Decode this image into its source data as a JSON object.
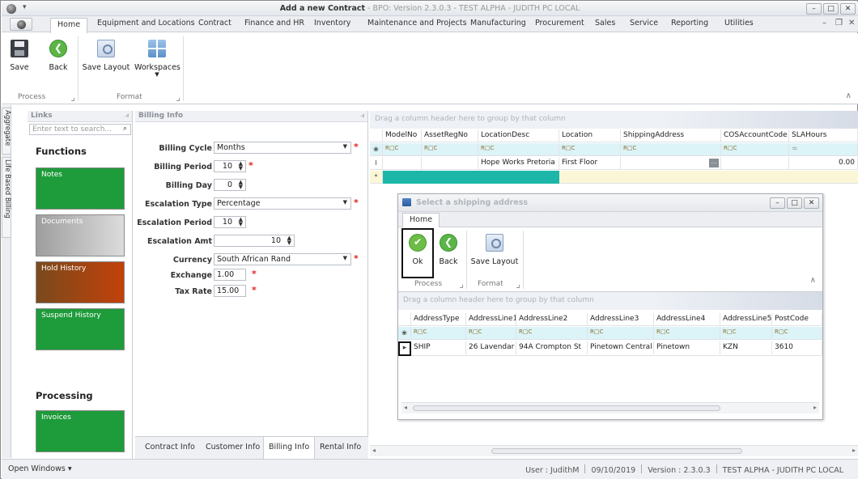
{
  "window": {
    "title_main": "Add a new Contract",
    "title_sub": " - BPO: Version 2.3.0.3 - TEST ALPHA - JUDITH PC LOCAL",
    "qat_glyph": "▾",
    "min": "–",
    "max": "□",
    "close": "✕"
  },
  "ribbon_tabs": [
    "Home",
    "Equipment and Locations",
    "Contract",
    "Finance and HR",
    "Inventory",
    "Maintenance and Projects",
    "Manufacturing",
    "Procurement",
    "Sales",
    "Service",
    "Reporting",
    "Utilities"
  ],
  "mdi_controls": {
    "min": "–",
    "restore": "❐",
    "close": "✕"
  },
  "ribbon": {
    "save": "Save",
    "back": "Back",
    "save_layout": "Save Layout",
    "workspaces": "Workspaces",
    "group_process": "Process",
    "group_format": "Format",
    "collapse": "∧"
  },
  "side_tabs": [
    "Aggregate",
    "Life Based Billing"
  ],
  "links": {
    "header": "Links",
    "pin": "⫣",
    "search_placeholder": "Enter text to search...",
    "search_icon": "⌕",
    "functions_title": "Functions",
    "tiles": [
      "Notes",
      "Documents",
      "Hold History",
      "Suspend History"
    ],
    "processing_title": "Processing",
    "processing_tiles": [
      "Invoices"
    ]
  },
  "billing": {
    "header": "Billing Info",
    "pin": "⫣",
    "fields": {
      "billing_cycle": {
        "label": "Billing Cycle",
        "value": "Months"
      },
      "billing_period": {
        "label": "Billing Period",
        "value": "10"
      },
      "billing_day": {
        "label": "Billing Day",
        "value": "0"
      },
      "escalation_type": {
        "label": "Escalation Type",
        "value": "Percentage"
      },
      "escalation_period": {
        "label": "Escalation Period",
        "value": "10"
      },
      "escalation_amt": {
        "label": "Escalation Amt",
        "value": "10"
      },
      "currency": {
        "label": "Currency",
        "value": "South African Rand"
      },
      "exchange": {
        "label": "Exchange",
        "value": "1.00"
      },
      "tax_rate": {
        "label": "Tax Rate",
        "value": "15.00"
      }
    },
    "required_mark": "*",
    "tabs": [
      "Contract Info",
      "Customer Info",
      "Billing Info",
      "Rental Info"
    ],
    "active_tab": "Billing Info"
  },
  "grid": {
    "group_hint": "Drag a column header here to group by that column",
    "columns": [
      "ModelNo",
      "AssetRegNo",
      "LocationDesc",
      "Location",
      "ShippingAddress",
      "COSAccountCode",
      "SLAHours"
    ],
    "filter_glyph": "R□C",
    "row": {
      "indicator": "I",
      "LocationDesc": "Hope Works Pretoria",
      "Location": "First Floor",
      "ShippingAddress_btn": "...",
      "SLAHours": "0.00"
    },
    "new_row_indicator": "*",
    "filter_indicator": "❀",
    "sla_filter": "="
  },
  "dialog": {
    "title": "Select a shipping address",
    "tab": "Home",
    "ok": "Ok",
    "back": "Back",
    "save_layout": "Save Layout",
    "group_process": "Process",
    "group_format": "Format",
    "collapse": "∧",
    "group_hint": "Drag a column header here to group by that column",
    "columns": [
      "AddressType",
      "AddressLine1",
      "AddressLine2",
      "AddressLine3",
      "AddressLine4",
      "AddressLine5",
      "PostCode"
    ],
    "row": {
      "AddressType": "SHIP",
      "AddressLine1": "26 Lavendar",
      "AddressLine2": "94A Crompton St",
      "AddressLine3": "Pinetown Central",
      "AddressLine4": "Pinetown",
      "AddressLine5": "KZN",
      "PostCode": "3610"
    },
    "row_indicator": "▸",
    "filter_indicator": "❀",
    "scroll_left": "◂",
    "scroll_right": "▸"
  },
  "status": {
    "open_windows": "Open Windows ▾",
    "user": "User : JudithM",
    "date": "09/10/2019",
    "version": "Version : 2.3.0.3",
    "env": "TEST ALPHA - JUDITH PC LOCAL"
  },
  "colors": {
    "accent_tile_green": "#1e9b3a",
    "filter_row": "#dcf3f7",
    "teal_row": "#1cb7a8",
    "required": "#e02020"
  }
}
